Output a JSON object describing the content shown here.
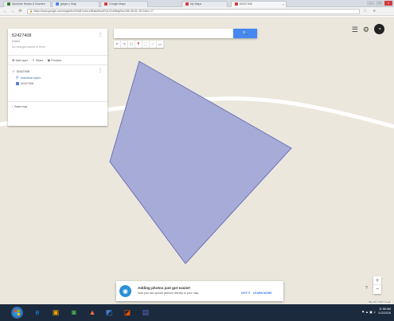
{
  "browser": {
    "tabs": [
      {
        "title": "Sprinkler Heads & Nozzles",
        "favicon_color": "#2e7d32",
        "active": false
      },
      {
        "title": "gisgeo | Map",
        "favicon_color": "#4285f4",
        "active": false
      },
      {
        "title": "Google Maps",
        "favicon_color": "#d23b3b",
        "active": false
      },
      {
        "title": "My Maps",
        "favicon_color": "#d23b3b",
        "active": false
      },
      {
        "title": "52427408",
        "favicon_color": "#d23b3b",
        "active": true
      }
    ],
    "url": "https://www.google.com/maps/d/u/0/edit?mid=z4fksduBzo6Y.kUZcIABrgRzuV&ll=38.62,-90.24&z=17",
    "nav": {
      "back": "←",
      "forward": "→",
      "reload": "⟳"
    },
    "star_icon": "☆",
    "menu_icon": "≡"
  },
  "map": {
    "colors": {
      "land": "#ebe7dc",
      "road": "#ffffff",
      "polygon_fill": "#a7abd8",
      "polygon_stroke": "#6d73b8"
    }
  },
  "panel": {
    "title": "52427408",
    "subtitle": "Edited",
    "description": "No changes saved to Drive",
    "actions": [
      {
        "icon": "⊕",
        "label": "Add layer"
      },
      {
        "icon": "⇪",
        "label": "Share"
      },
      {
        "icon": "◉",
        "label": "Preview"
      }
    ],
    "layer": {
      "name": "52427408",
      "style": "Individual styles",
      "item": "52427408"
    },
    "base_map": "Base map"
  },
  "search": {
    "placeholder": "",
    "button_icon": "🔍"
  },
  "tools": [
    "↶",
    "↷",
    "☐",
    "📍",
    "⛶",
    "⟋",
    "▭"
  ],
  "top_right": {
    "list_icon": "☰",
    "settings_icon": "⚙",
    "avatar_letter": "◔"
  },
  "toast": {
    "title": "Adding photos just got easier!",
    "body": "Now you can upload pictures directly to your map.",
    "got_it": "GOT IT",
    "learn_more": "LEARN MORE"
  },
  "zoom": {
    "plus": "+",
    "minus": "−",
    "help": "?"
  },
  "attribution": "Map data ©2015 Google",
  "taskbar": {
    "apps": [
      {
        "icon": "e",
        "color": "#1e88e5"
      },
      {
        "icon": "▣",
        "color": "#f4a300"
      },
      {
        "icon": "◙",
        "color": "#4caf50"
      },
      {
        "icon": "▲",
        "color": "#ff7043"
      },
      {
        "icon": "◩",
        "color": "#3f7fd4"
      },
      {
        "icon": "◪",
        "color": "#e65100"
      },
      {
        "icon": "▤",
        "color": "#5c6bc0"
      }
    ],
    "tray_icons": "⚑ ▲ ▣ ♫",
    "time": "11:58 AM",
    "date": "1/12/2016"
  }
}
